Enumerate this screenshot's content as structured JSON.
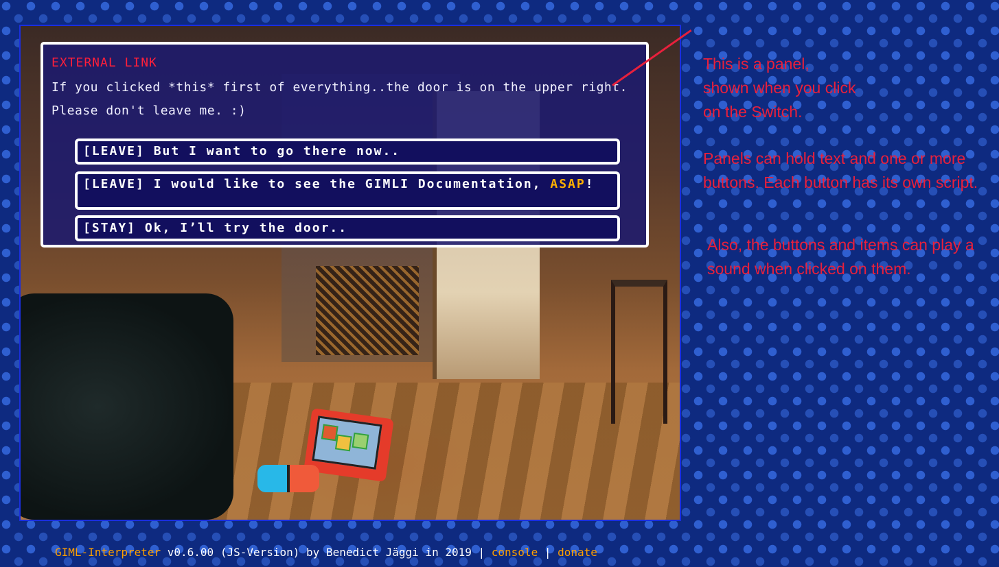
{
  "panel": {
    "title": "EXTERNAL LINK",
    "text": "If you clicked *this* first of everything..the door is on the upper right. Please don't leave me. :)",
    "buttons": [
      {
        "label": "[LEAVE] But I want to go there now.."
      },
      {
        "label_part1": "[LEAVE] I would like to see the GIMLI Documentation, ",
        "highlight": "ASAP",
        "label_part2": "!"
      },
      {
        "label": "[STAY] Ok, I’ll try the door.."
      }
    ]
  },
  "annotations": {
    "note1": "This is a panel,\nshown when you click\non the Switch.",
    "note2": "Panels can hold text and one or more buttons. Each button has its own script.",
    "note3": "Also, the buttons and items can play a sound when clicked on them."
  },
  "footer": {
    "app_link": "GIML-Interpreter",
    "info": " v0.6.00 (JS-Version) by Benedict Jäggi in 2019 | ",
    "console_link": "console",
    "separator": " | ",
    "donate_link": "donate"
  },
  "colors": {
    "panel_title": "#ff1f3a",
    "highlight": "#ffb000",
    "annotation": "#e8203c",
    "footer_link": "#ffa000"
  }
}
